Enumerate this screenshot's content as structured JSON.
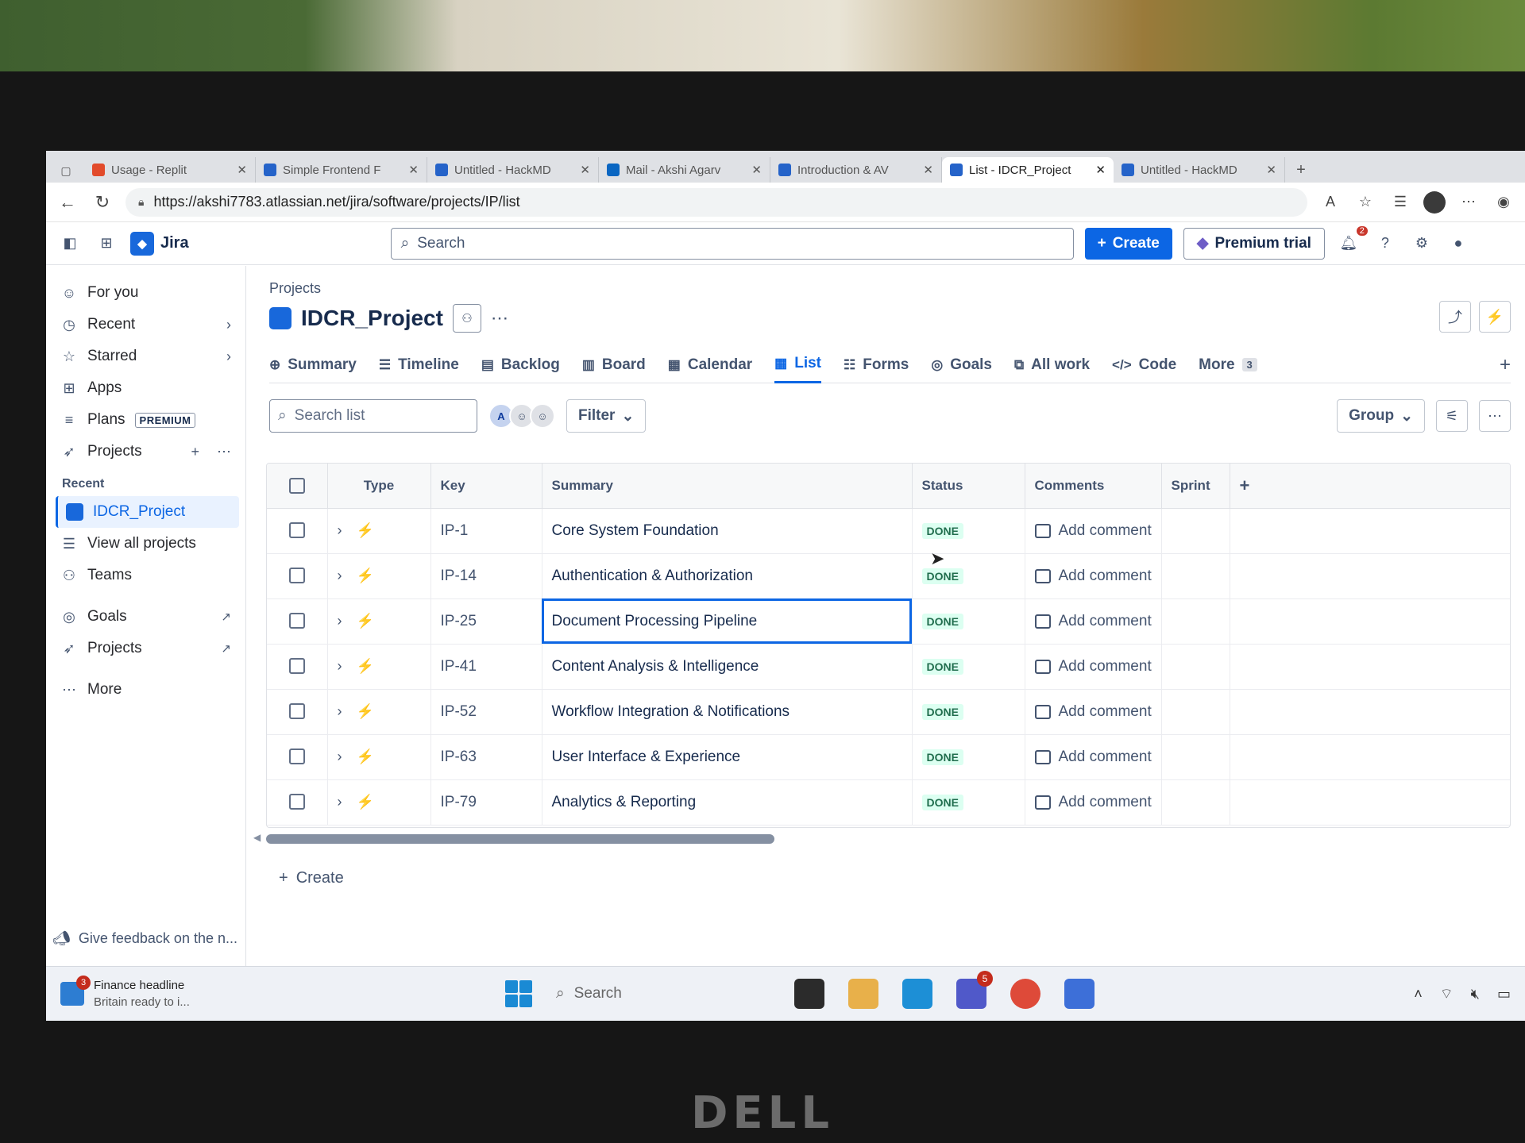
{
  "browser": {
    "tabs": [
      {
        "title": "Usage - Replit",
        "icon": "replit-icon",
        "active": false
      },
      {
        "title": "Simple Frontend F",
        "icon": "web-icon",
        "active": false
      },
      {
        "title": "Untitled - HackMD",
        "icon": "hackmd-icon",
        "active": false
      },
      {
        "title": "Mail - Akshi Agarv",
        "icon": "outlook-icon",
        "active": false
      },
      {
        "title": "Introduction & AV",
        "icon": "web-icon",
        "active": false
      },
      {
        "title": "List - IDCR_Project",
        "icon": "jira-icon",
        "active": true
      },
      {
        "title": "Untitled - HackMD",
        "icon": "hackmd-icon",
        "active": false
      }
    ],
    "url": "https://akshi7783.atlassian.net/jira/software/projects/IP/list"
  },
  "topnav": {
    "app_name": "Jira",
    "search_placeholder": "Search",
    "create_label": "Create",
    "premium_label": "Premium trial",
    "notification_count": "2"
  },
  "sidebar": {
    "items": [
      {
        "label": "For you",
        "icon": "user-circle-icon"
      },
      {
        "label": "Recent",
        "icon": "clock-icon"
      },
      {
        "label": "Starred",
        "icon": "star-icon"
      },
      {
        "label": "Apps",
        "icon": "apps-icon"
      },
      {
        "label": "Plans",
        "icon": "plans-icon",
        "badge": "PREMIUM"
      },
      {
        "label": "Projects",
        "icon": "rocket-icon"
      }
    ],
    "recent_heading": "Recent",
    "selected_project": "IDCR_Project",
    "view_all": "View all projects",
    "teams": "Teams",
    "goals": "Goals",
    "projects_link": "Projects",
    "more": "More",
    "feedback": "Give feedback on the n..."
  },
  "project": {
    "breadcrumb": "Projects",
    "title": "IDCR_Project",
    "tabs": [
      "Summary",
      "Timeline",
      "Backlog",
      "Board",
      "Calendar",
      "List",
      "Forms",
      "Goals",
      "All work",
      "Code",
      "More"
    ],
    "active_tab": "List",
    "more_count": "3"
  },
  "toolbar": {
    "search_placeholder": "Search list",
    "filter_label": "Filter",
    "group_label": "Group",
    "avatar_initial": "A"
  },
  "table": {
    "headers": {
      "type": "Type",
      "key": "Key",
      "summary": "Summary",
      "status": "Status",
      "comments": "Comments",
      "sprint": "Sprint"
    },
    "rows": [
      {
        "key": "IP-1",
        "summary": "Core System Foundation",
        "status": "DONE",
        "comment": "Add comment"
      },
      {
        "key": "IP-14",
        "summary": "Authentication & Authorization",
        "status": "DONE",
        "comment": "Add comment"
      },
      {
        "key": "IP-25",
        "summary": "Document Processing Pipeline",
        "status": "DONE",
        "comment": "Add comment"
      },
      {
        "key": "IP-41",
        "summary": "Content Analysis & Intelligence",
        "status": "DONE",
        "comment": "Add comment"
      },
      {
        "key": "IP-52",
        "summary": "Workflow Integration & Notifications",
        "status": "DONE",
        "comment": "Add comment"
      },
      {
        "key": "IP-63",
        "summary": "User Interface & Experience",
        "status": "DONE",
        "comment": "Add comment"
      },
      {
        "key": "IP-79",
        "summary": "Analytics & Reporting",
        "status": "DONE",
        "comment": "Add comment"
      }
    ],
    "focused_row": 2,
    "create_label": "Create"
  },
  "taskbar": {
    "news_title": "Finance headline",
    "news_sub": "Britain ready to i...",
    "news_badge": "3",
    "search_placeholder": "Search",
    "teams_badge": "5"
  },
  "colors": {
    "accent": "#0c66e4",
    "done_bg": "#dcfff1",
    "done_fg": "#216e4e"
  },
  "bezel_brand": "DELL"
}
